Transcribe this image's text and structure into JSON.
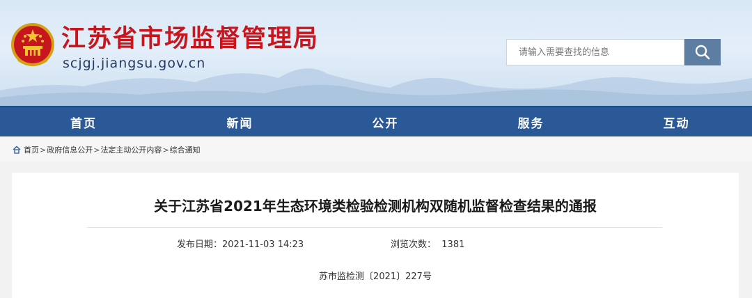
{
  "header": {
    "site_title": "江苏省市场监督管理局",
    "site_domain": "scjgj.jiangsu.gov.cn",
    "emblem_icon": "national-emblem-icon"
  },
  "search": {
    "placeholder": "请输入需要查找的信息",
    "button_icon": "search-icon"
  },
  "nav": {
    "items": [
      {
        "label": "首页"
      },
      {
        "label": "新闻"
      },
      {
        "label": "公开"
      },
      {
        "label": "服务"
      },
      {
        "label": "互动"
      }
    ]
  },
  "breadcrumb": {
    "icon": "home-icon",
    "items": [
      "首页",
      "政府信息公开",
      "法定主动公开内容",
      "综合通知"
    ],
    "separator": ">"
  },
  "article": {
    "title": "关于江苏省2021年生态环境类检验检测机构双随机监督检查结果的通报",
    "publish_label": "发布日期：",
    "publish_date": "2021-11-03 14:23",
    "views_label": "浏览次数：",
    "views": "1381",
    "doc_number": "苏市监检测〔2021〕227号"
  },
  "colors": {
    "title_red": "#c8161e",
    "nav_blue": "#2b5896",
    "search_button": "#5d7ea2"
  }
}
